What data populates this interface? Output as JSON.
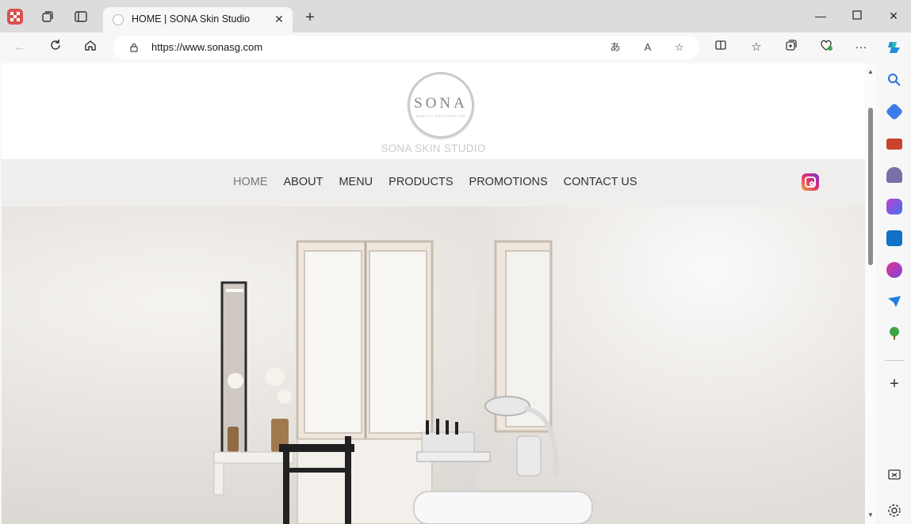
{
  "browser": {
    "tab_title": "HOME | SONA Skin Studio",
    "url": "https://www.sonasg.com"
  },
  "site": {
    "logo_text": "SONA",
    "logo_subtitle": "BEAUTY DESTINATION",
    "name": "SONA SKIN STUDIO",
    "menu": [
      "HOME",
      "ABOUT",
      "MENU",
      "PRODUCTS",
      "PROMOTIONS",
      "CONTACT US"
    ],
    "active_menu": "HOME"
  },
  "icons": {
    "titlebar": [
      "profile-icon",
      "workspaces-icon",
      "tab-actions-icon"
    ],
    "toolbar": [
      "back-icon",
      "refresh-icon",
      "home-icon"
    ],
    "address": [
      "translate-icon",
      "read-aloud-icon",
      "favorite-star-icon"
    ],
    "toolbar_right": [
      "split-screen-icon",
      "favorites-icon",
      "collections-icon",
      "browser-essentials-icon",
      "more-icon",
      "copilot-icon"
    ],
    "sidebar": [
      "search-icon",
      "shopping-icon",
      "tools-icon",
      "games-icon",
      "office-icon",
      "outlook-icon",
      "designer-icon",
      "send-icon",
      "tree-icon",
      "add-icon",
      "screenshot-icon",
      "settings-icon"
    ]
  },
  "colors": {
    "accent": "#0f6cbd",
    "site_name": "#cfc9c7",
    "nav_band": "#efeeec"
  }
}
